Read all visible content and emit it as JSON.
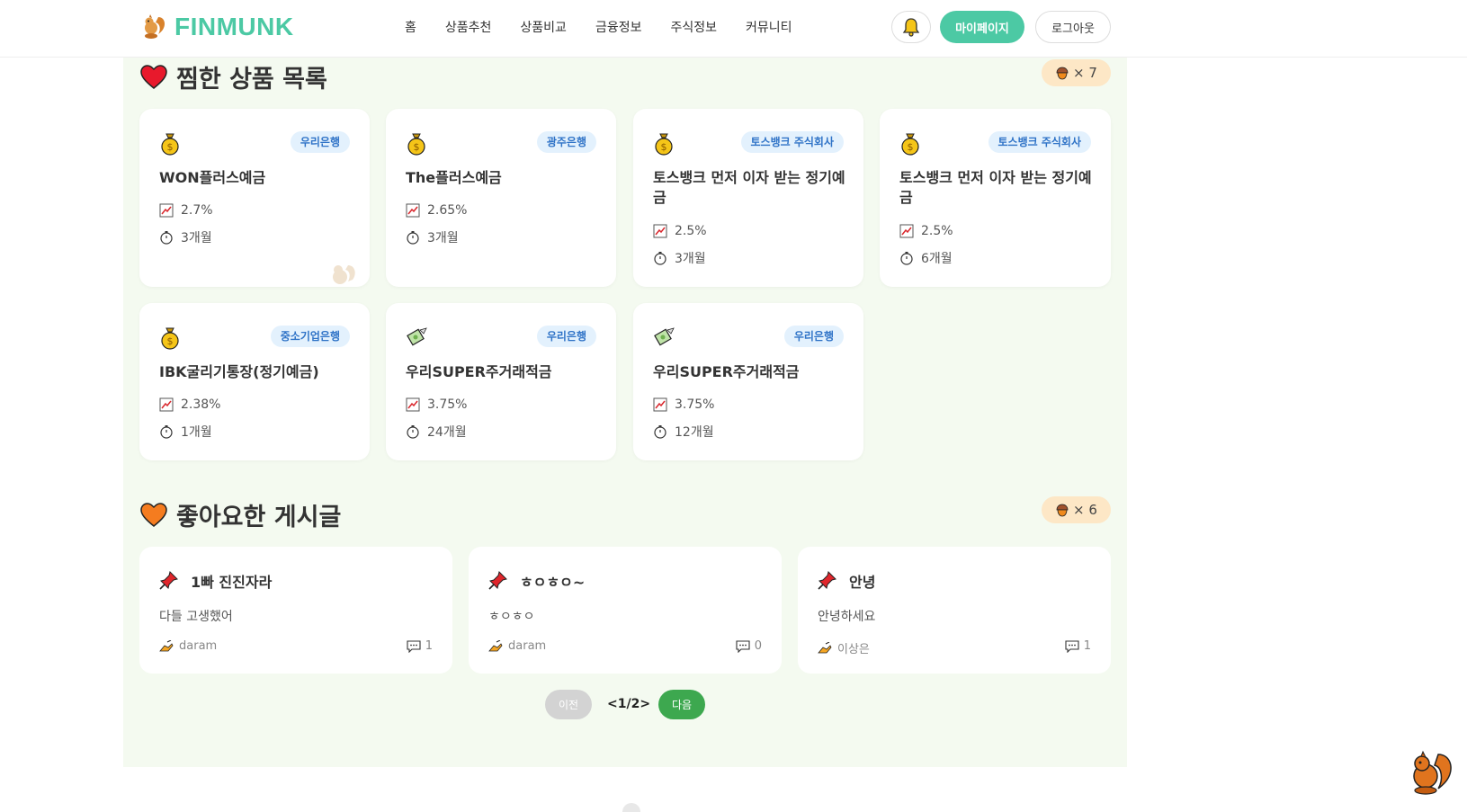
{
  "header": {
    "logo_text": "FINMUNK",
    "nav": [
      "홈",
      "상품추천",
      "상품비교",
      "금융정보",
      "주식정보",
      "커뮤니티"
    ],
    "mypage_label": "마이페이지",
    "logout_label": "로그아웃"
  },
  "wishlist": {
    "title": "찜한 상품 목록",
    "count": "× 7",
    "products": [
      {
        "icon": "money-bag-icon",
        "bank": "우리은행",
        "name": "WON플러스예금",
        "rate": "2.7%",
        "period": "3개월"
      },
      {
        "icon": "money-bag-icon",
        "bank": "광주은행",
        "name": "The플러스예금",
        "rate": "2.65%",
        "period": "3개월"
      },
      {
        "icon": "money-bag-icon",
        "bank": "토스뱅크 주식회사",
        "name": "토스뱅크 먼저 이자 받는 정기예금",
        "rate": "2.5%",
        "period": "3개월"
      },
      {
        "icon": "money-bag-icon",
        "bank": "토스뱅크 주식회사",
        "name": "토스뱅크 먼저 이자 받는 정기예금",
        "rate": "2.5%",
        "period": "6개월"
      },
      {
        "icon": "money-bag-icon",
        "bank": "중소기업은행",
        "name": "IBK굴리기통장(정기예금)",
        "rate": "2.38%",
        "period": "1개월"
      },
      {
        "icon": "money-with-wings-icon",
        "bank": "우리은행",
        "name": "우리SUPER주거래적금",
        "rate": "3.75%",
        "period": "24개월"
      },
      {
        "icon": "money-with-wings-icon",
        "bank": "우리은행",
        "name": "우리SUPER주거래적금",
        "rate": "3.75%",
        "period": "12개월"
      }
    ]
  },
  "liked_posts": {
    "title": "좋아요한 게시글",
    "count": "× 6",
    "posts": [
      {
        "title": "1빠 진진자라",
        "body": "다들 고생했어",
        "author": "daram",
        "comments": "1"
      },
      {
        "title": "ㅎㅇㅎㅇ~",
        "body": "ㅎㅇㅎㅇ",
        "author": "daram",
        "comments": "0"
      },
      {
        "title": "안녕",
        "body": "안녕하세요",
        "author": "이상은",
        "comments": "1"
      }
    ]
  },
  "pager": {
    "prev_label": "이전",
    "page_label": "<1/2>",
    "next_label": "다음"
  },
  "colors": {
    "brand": "#4cc9a4",
    "panel_bg": "#f4faf0",
    "bank_badge_bg": "#e3f1fd",
    "bank_badge_text": "#2f73c7",
    "next_button": "#3da84f",
    "count_badge_bg": "#fde7c6"
  }
}
